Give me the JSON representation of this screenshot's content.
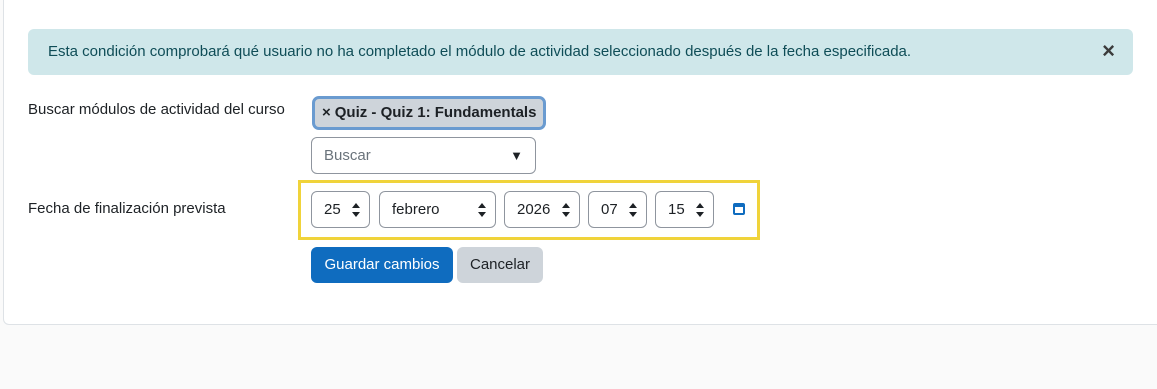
{
  "alert": {
    "message": "Esta condición comprobará qué usuario no ha completado el módulo de actividad seleccionado después de la fecha especificada.",
    "close_symbol": "×"
  },
  "form": {
    "activity_label": "Buscar módulos de actividad del curso",
    "selected_chip": {
      "remove_symbol": "×",
      "text": "Quiz - Quiz 1: Fundamentals"
    },
    "search": {
      "placeholder": "Buscar",
      "arrow": "▼"
    },
    "date_label": "Fecha de finalización prevista",
    "date": {
      "day": "25",
      "month": "febrero",
      "year": "2026",
      "hour": "07",
      "minute": "15"
    },
    "calendar_icon": "calendar-icon"
  },
  "buttons": {
    "save": "Guardar cambios",
    "cancel": "Cancelar"
  },
  "colors": {
    "alert_bg": "#cfe7ea",
    "primary": "#0f6cbf",
    "highlight": "#f0d33a"
  }
}
